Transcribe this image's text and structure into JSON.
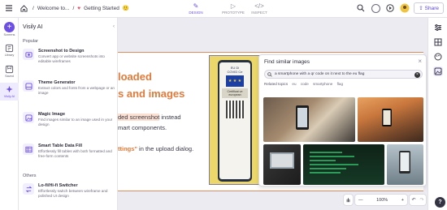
{
  "topbar": {
    "breadcrumb_home": "Welcome to...",
    "breadcrumb_sep": "/",
    "doc_title": "Getting Started",
    "modes": [
      "DESIGN",
      "PROTOTYPE",
      "INSPECT"
    ],
    "share_label": "Share"
  },
  "rail": {
    "items": [
      {
        "label": "Screens",
        "icon": "plus-icon"
      },
      {
        "label": "Library",
        "icon": "library-icon"
      },
      {
        "label": "Saved",
        "icon": "saved-icon"
      },
      {
        "label": "Visily AI",
        "icon": "sparkle-icon"
      }
    ]
  },
  "panel": {
    "title": "Visily AI",
    "section_popular": "Popular",
    "section_others": "Others",
    "features": [
      {
        "title": "Screenshot to Design",
        "desc": "Convert app or website screenshots into editable wireframes",
        "icon": "screenshot-icon"
      },
      {
        "title": "Theme Generator",
        "desc": "Extract colors and fonts from a webpage or an image",
        "icon": "palette-icon"
      },
      {
        "title": "Magic Image",
        "desc": "Find images similar to an image used in your design",
        "icon": "magic-image-icon"
      },
      {
        "title": "Smart Table Data Fill",
        "desc": "Effortlessly fill tables with both formatted and free-form contents",
        "icon": "table-icon"
      },
      {
        "title": "Lo-fi/Hi-fi Switcher",
        "desc": "Effortlessly switch between wireframe and polished UI design",
        "icon": "switch-icon"
      }
    ]
  },
  "canvas": {
    "heading_line1": "loaded",
    "heading_line2": "s and images",
    "body_line1_hl": "ded screenshot",
    "body_line1_rest": " instead",
    "body_line2": "mart components.",
    "body_line3_link": "ttings\"",
    "body_line3_rest": " in the upload dialog.",
    "phone_head": "EU Di",
    "phone_head2": "COVID Ce",
    "phone_cert": "Certificat ve european",
    "phone_flag_stars": "★ ★ ★"
  },
  "popup": {
    "title": "Find similar images",
    "search_value": "a smartphone with a qr code on it next to the eu flag",
    "topics_label": "Related topics",
    "topics": [
      "eu",
      "code",
      "smartphone",
      "flag"
    ]
  },
  "zoom": {
    "minus": "—",
    "value": "100%",
    "plus": "+"
  },
  "colors": {
    "accent": "#6d4fe8",
    "orange": "#e27a3a"
  }
}
